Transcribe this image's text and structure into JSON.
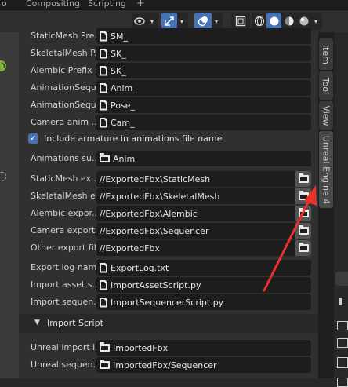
{
  "top_tabs": [
    "o",
    "Compositing",
    "Scripting"
  ],
  "header": {
    "icons": [
      "eye-icon",
      "chevron-down-icon",
      "gizmo-icon",
      "chevron-down-icon",
      "overlay-icon",
      "chevron-down-icon",
      "xray-icon",
      "shading-wire-icon",
      "shading-solid-icon",
      "shading-material-icon",
      "shading-render-icon",
      "chevron-down-icon"
    ]
  },
  "side_tabs": [
    "Item",
    "Tool",
    "View",
    "Unreal Engine 4"
  ],
  "prefix_rows": [
    {
      "label": "StaticMesh Pre...",
      "value": "SM_"
    },
    {
      "label": "SkeletalMesh P...",
      "value": "SK_"
    },
    {
      "label": "Alembic Prefix :",
      "value": "SK_"
    },
    {
      "label": "AnimationSequ...",
      "value": "Anim_"
    },
    {
      "label": "AnimationSequ...",
      "value": "Pose_"
    },
    {
      "label": "Camera anim ...",
      "value": "Cam_"
    }
  ],
  "checkbox": {
    "label": "Include armature in animations file name",
    "checked": true
  },
  "anim_row": {
    "label": "Animations su...",
    "value": "Anim"
  },
  "export_rows": [
    {
      "label": "StaticMesh ex...",
      "value": "//ExportedFbx\\StaticMesh"
    },
    {
      "label": "SkeletalMesh e...",
      "value": "//ExportedFbx\\SkeletalMesh"
    },
    {
      "label": "Alembic expor...",
      "value": "//ExportedFbx\\Alembic"
    },
    {
      "label": "Camera export...",
      "value": "//ExportedFbx\\Sequencer"
    },
    {
      "label": "Other export fil...",
      "value": "//ExportedFbx"
    }
  ],
  "file_rows": [
    {
      "label": "Export log nam...",
      "value": "ExportLog.txt"
    },
    {
      "label": "Import asset s...",
      "value": "ImportAssetScript.py"
    },
    {
      "label": "Import sequen...",
      "value": "ImportSequencerScript.py"
    }
  ],
  "import_section": {
    "title": "Import Script"
  },
  "import_rows": [
    {
      "label": "Unreal import l...",
      "value": "ImportedFbx"
    },
    {
      "label": "Unreal sequen...",
      "value": "ImportedFbx/Sequencer"
    }
  ],
  "colors": {
    "accent": "#4772b3",
    "arrow": "#e8322a",
    "panel": "#303030",
    "field": "#1d1d1d"
  }
}
